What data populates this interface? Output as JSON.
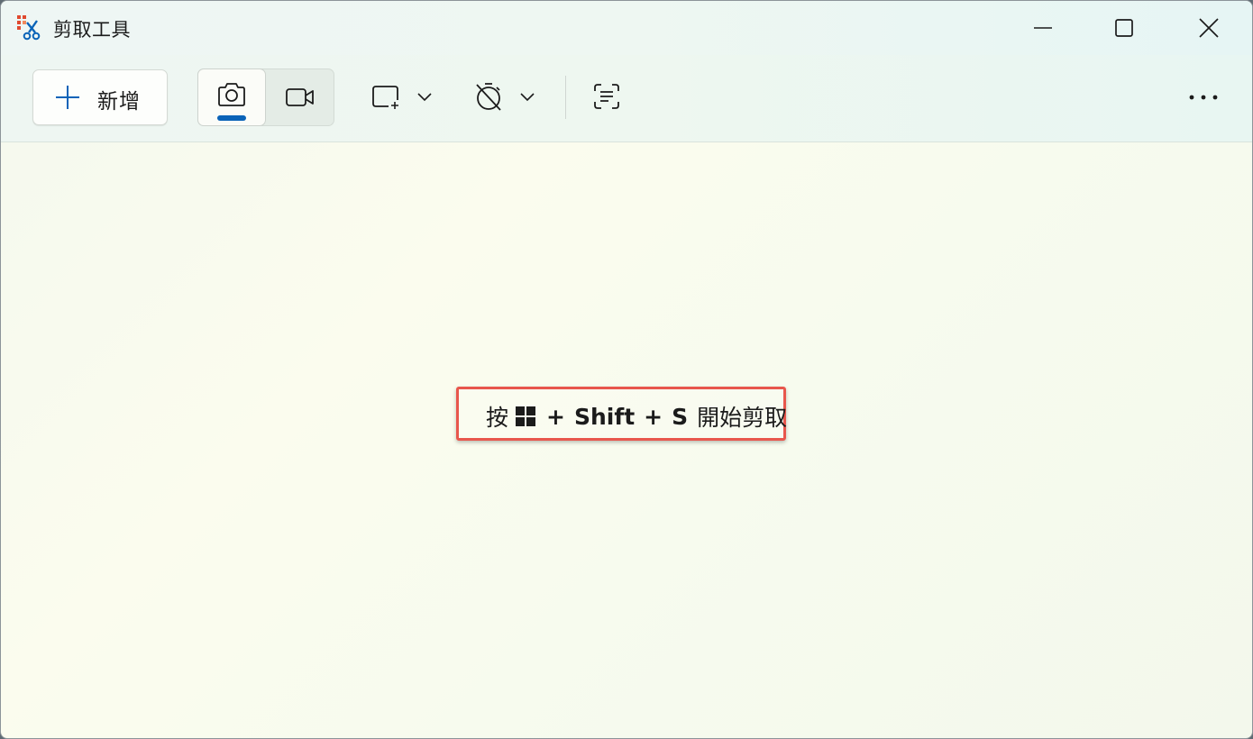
{
  "window": {
    "title": "剪取工具",
    "app_icon": "snipping-tool-icon"
  },
  "window_controls": {
    "minimize_icon": "minimize-icon",
    "maximize_icon": "maximize-icon",
    "close_icon": "close-icon"
  },
  "toolbar": {
    "new_label": "新增",
    "new_icon": "plus-icon",
    "modes": [
      {
        "name": "screenshot",
        "icon": "camera-icon",
        "selected": true
      },
      {
        "name": "video",
        "icon": "video-camera-icon",
        "selected": false
      }
    ],
    "shape_icon": "rectangle-snip-icon",
    "timer_icon": "timer-off-icon",
    "text_action_icon": "text-actions-icon",
    "more_icon": "more-icon"
  },
  "hint": {
    "press": "按",
    "key_icon": "windows-key-icon",
    "plus1": "+",
    "shift": "Shift",
    "plus2": "+",
    "s": "S",
    "action": "開始剪取"
  },
  "colors": {
    "accent": "#0a63b8",
    "highlight_border": "#e8564c"
  }
}
